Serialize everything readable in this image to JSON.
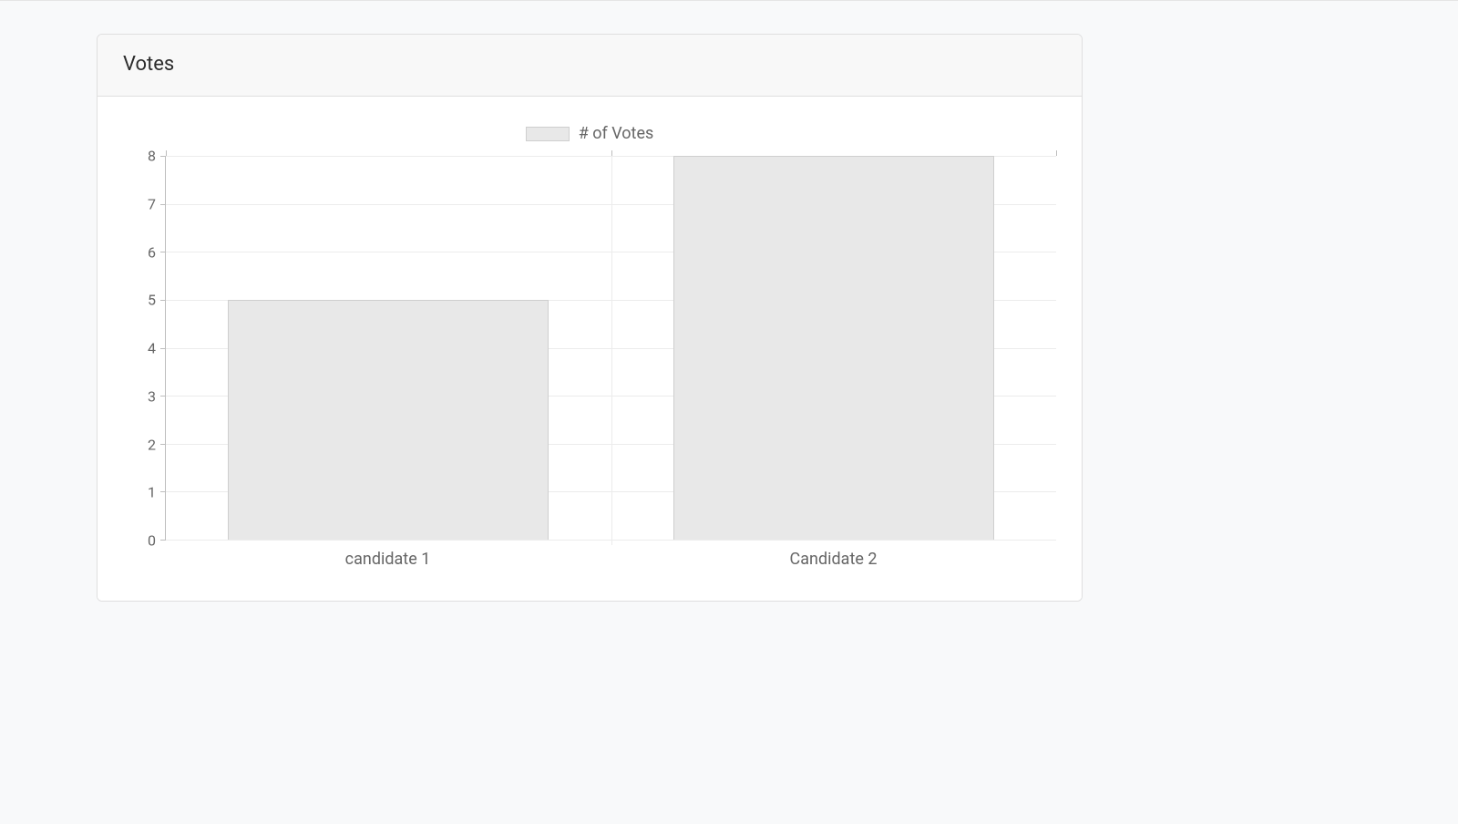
{
  "card": {
    "title": "Votes"
  },
  "chart_data": {
    "type": "bar",
    "legend": "# of Votes",
    "categories": [
      "candidate 1",
      "Candidate 2"
    ],
    "values": [
      5,
      8
    ],
    "ylim": [
      0,
      8
    ],
    "yticks": [
      0,
      1,
      2,
      3,
      4,
      5,
      6,
      7,
      8
    ],
    "bar_color": "#e8e8e8",
    "bar_border": "#cfcfcf"
  }
}
